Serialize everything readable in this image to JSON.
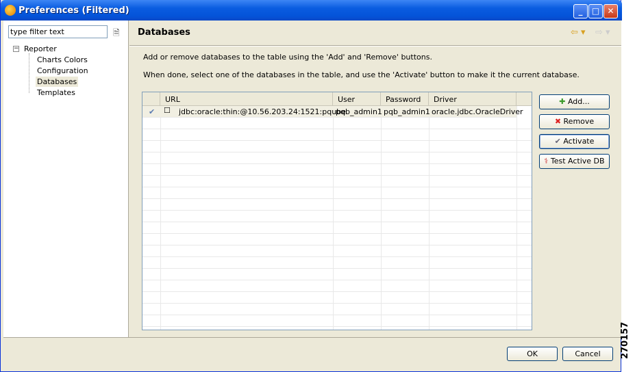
{
  "window": {
    "title": "Preferences (Filtered)",
    "minimize": "_",
    "maximize": "□",
    "close": "✕"
  },
  "sidebar": {
    "filter_placeholder": "type filter text",
    "filter_value": "type filter text",
    "root": "Reporter",
    "root_toggle": "−",
    "items": [
      {
        "label": "Charts Colors"
      },
      {
        "label": "Configuration"
      },
      {
        "label": "Databases",
        "selected": true
      },
      {
        "label": "Templates"
      }
    ]
  },
  "page": {
    "title": "Databases",
    "back": "⇦ ▾",
    "forward": "⇨ ▾",
    "desc1": "Add or remove databases to the table using the 'Add' and 'Remove' buttons.",
    "desc2": "When done, select one of the databases in the table, and use the 'Activate' button to make it the current database."
  },
  "table": {
    "columns": [
      "",
      "URL",
      "User",
      "Password",
      "Driver"
    ],
    "rows": [
      {
        "active": "✔",
        "checkbox": "☐",
        "url": "jdbc:oracle:thin:@10.56.203.24:1521:pqube",
        "user": "pqb_admin1",
        "password": "pqb_admin1",
        "driver": "oracle.jdbc.OracleDriver"
      }
    ]
  },
  "buttons": {
    "add": "Add...",
    "remove": "Remove",
    "activate": "Activate",
    "test": "Test Active DB",
    "add_icon": "✚",
    "remove_icon": "✖",
    "activate_icon": "✔",
    "test_icon": "⚕"
  },
  "footer": {
    "ok": "OK",
    "cancel": "Cancel"
  },
  "figure_id": "270157"
}
